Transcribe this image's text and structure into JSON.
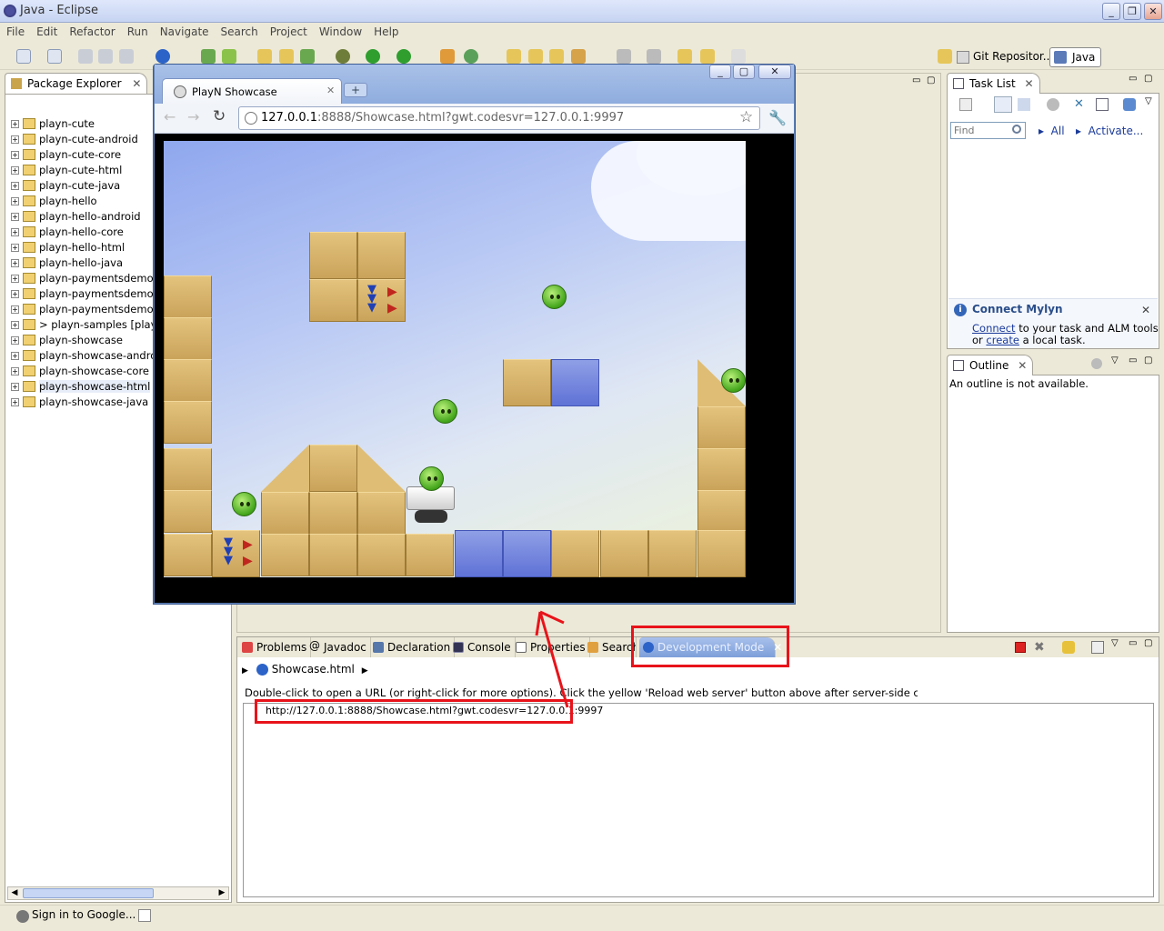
{
  "window": {
    "title": "Java - Eclipse"
  },
  "menu": [
    "File",
    "Edit",
    "Refactor",
    "Run",
    "Navigate",
    "Search",
    "Project",
    "Window",
    "Help"
  ],
  "perspectives": {
    "git": "Git Repositor...",
    "java": "Java"
  },
  "package_explorer": {
    "title": "Package Explorer",
    "items": [
      "playn-cute",
      "playn-cute-android",
      "playn-cute-core",
      "playn-cute-html",
      "playn-cute-java",
      "playn-hello",
      "playn-hello-android",
      "playn-hello-core",
      "playn-hello-html",
      "playn-hello-java",
      "playn-paymentsdemo",
      "playn-paymentsdemo-c",
      "playn-paymentsdemo-h",
      "> playn-samples [playn",
      "playn-showcase",
      "playn-showcase-andro",
      "playn-showcase-core",
      "playn-showcase-html",
      "playn-showcase-java"
    ]
  },
  "task_list": {
    "title": "Task List",
    "find_placeholder": "Find",
    "all": "All",
    "activate": "Activate..."
  },
  "mylyn": {
    "title": "Connect Mylyn",
    "line1_link": "Connect",
    "line1_rest": " to your task and ALM tools",
    "line2_pre": "or ",
    "line2_link": "create",
    "line2_rest": " a local task."
  },
  "outline": {
    "title": "Outline",
    "message": "An outline is not available."
  },
  "bottom_tabs": [
    "Problems",
    "Javadoc",
    "Declaration",
    "Console",
    "Properties",
    "Search",
    "Development Mode"
  ],
  "devmode": {
    "breadcrumb": "Showcase.html",
    "hint": "Double-click to open a URL (or right-click for more options). Click the yellow 'Reload web server' button above after server-side code changes.",
    "url": "http://127.0.0.1:8888/Showcase.html?gwt.codesvr=127.0.0.1:9997"
  },
  "browser": {
    "tab_title": "PlayN Showcase",
    "url_host": "127.0.0.1",
    "url_rest": ":8888/Showcase.html?gwt.codesvr=127.0.0.1:9997"
  },
  "status": {
    "signin": "Sign in to Google..."
  },
  "colors": {
    "annotation": "#e8131a",
    "eclipse_bg": "#ece9d8",
    "link": "#1a3a9a"
  }
}
